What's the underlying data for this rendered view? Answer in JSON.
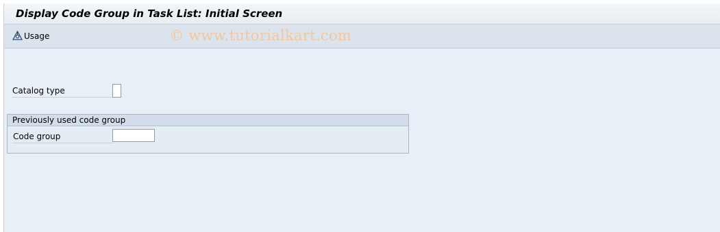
{
  "title": "Display Code Group in Task List: Initial Screen",
  "toolbar": {
    "usage_label": "Usage"
  },
  "watermark": "© www.tutorialkart.com",
  "fields": {
    "catalog_type_label": "Catalog type",
    "catalog_type_value": ""
  },
  "group": {
    "title": "Previously used code group",
    "code_group_label": "Code group",
    "code_group_value": ""
  }
}
